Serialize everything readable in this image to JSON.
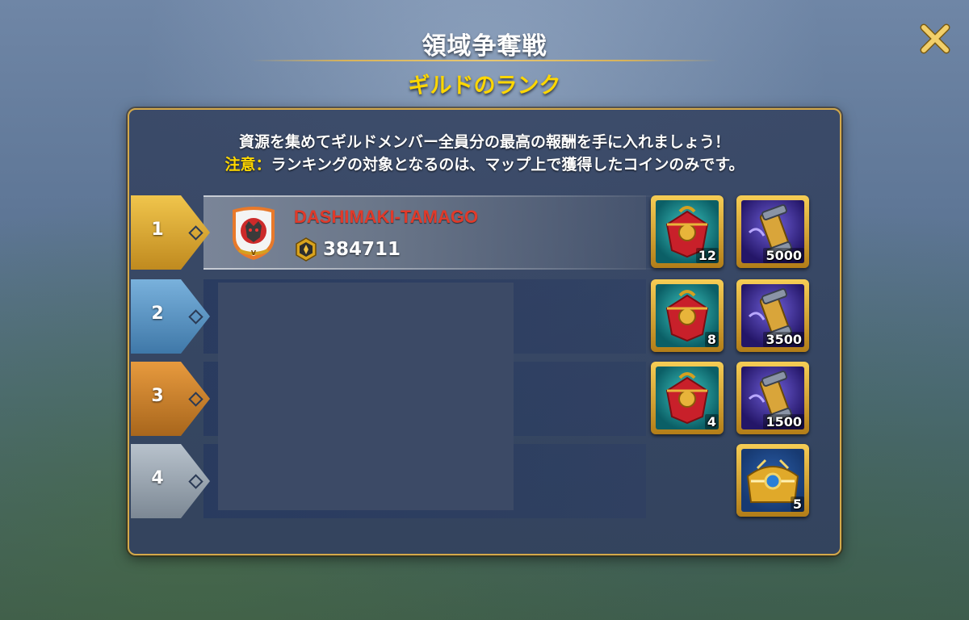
{
  "header": {
    "title": "領域争奪戦",
    "subtitle": "ギルドのランク"
  },
  "panel": {
    "description": "資源を集めてギルドメンバー全員分の最高の報酬を手に入れましょう！",
    "note_label": "注意：",
    "note_text": "ランキングの対象となるのは、マップ上で獲得したコインのみです。"
  },
  "ranks": [
    {
      "rank": "1",
      "guild_name": "DASHIMAKI-TAMAGO",
      "score": "384711",
      "rewards": [
        {
          "icon": "red-chest-icon",
          "qty": "12"
        },
        {
          "icon": "scroll-icon",
          "qty": "5000"
        }
      ]
    },
    {
      "rank": "2",
      "rewards": [
        {
          "icon": "red-chest-icon",
          "qty": "8"
        },
        {
          "icon": "scroll-icon",
          "qty": "3500"
        }
      ]
    },
    {
      "rank": "3",
      "rewards": [
        {
          "icon": "red-chest-icon",
          "qty": "4"
        },
        {
          "icon": "scroll-icon",
          "qty": "1500"
        }
      ]
    },
    {
      "rank": "4",
      "rewards": [
        {
          "icon": "golden-chest-icon",
          "qty": "5"
        }
      ]
    }
  ],
  "colors": {
    "gold_title": "#ffd700",
    "guild_name": "#e03a2a",
    "rank1_tab": "#d9a934",
    "rank2_tab": "#5b94c4",
    "rank3_tab": "#c9822f",
    "rank4_tab": "#9aa5b1",
    "panel_border": "#d4a94a"
  }
}
